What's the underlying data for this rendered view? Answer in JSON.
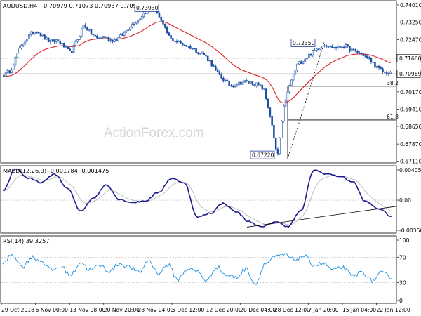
{
  "header": {
    "symbol": "AUDUSD,H4",
    "ohlc": "0.70979 0.71073 0.70937 0.70969"
  },
  "watermark": "ActionForex.com",
  "colors": {
    "candles": "#1a4fa3",
    "ema": "#e0202a",
    "macd": "#1c1c8c",
    "signal": "#b8b8b8",
    "rsi": "#1e90e0",
    "tag": "#1f3fa0"
  },
  "chart_data": [
    {
      "type": "candlestick",
      "title": "AUDUSD,H4",
      "ylim": [
        0.671,
        0.741
      ],
      "y_ticks": [
        "0.74010",
        "0.73250",
        "0.72470",
        "0.71660",
        "0.70969",
        "0.70170",
        "0.69410",
        "0.68650",
        "0.67870",
        "0.67110"
      ],
      "x_ticks": [
        "29 Oct 2018",
        "6 Nov 00:00",
        "13 Nov 08:00",
        "20 Nov 20:00",
        "28 Nov 04:00",
        "5 Dec 12:00",
        "12 Dec 20:00",
        "20 Dec 04:00",
        "28 Dec 12:00",
        "7 Jan 20:00",
        "15 Jan 04:00",
        "22 Jan 12:00"
      ],
      "current_price": 0.70969,
      "horizontal_level": 0.7166,
      "price_tags": [
        {
          "label": "0.73930",
          "value": 0.7393
        },
        {
          "label": "0.72350",
          "value": 0.7235
        },
        {
          "label": "0.67220",
          "value": 0.6722
        }
      ],
      "fib_levels": [
        {
          "label": "38.2",
          "value": 0.7042
        },
        {
          "label": "61.8",
          "value": 0.6893
        }
      ],
      "ema_visible": true,
      "close_path": [
        0.7091,
        0.7112,
        0.7184,
        0.7238,
        0.7272,
        0.7288,
        0.7256,
        0.7237,
        0.7246,
        0.7218,
        0.7187,
        0.7245,
        0.7315,
        0.7277,
        0.7253,
        0.7262,
        0.7246,
        0.7248,
        0.7275,
        0.731,
        0.733,
        0.7364,
        0.7388,
        0.7371,
        0.7302,
        0.7251,
        0.7238,
        0.7226,
        0.7214,
        0.7196,
        0.7182,
        0.7148,
        0.7101,
        0.707,
        0.7043,
        0.7052,
        0.7063,
        0.7058,
        0.7049,
        0.703,
        0.6905,
        0.6722,
        0.6954,
        0.7059,
        0.7136,
        0.7161,
        0.7185,
        0.7207,
        0.7228,
        0.7216,
        0.7212,
        0.7222,
        0.7203,
        0.719,
        0.718,
        0.7154,
        0.7123,
        0.7103,
        0.7097
      ]
    },
    {
      "type": "line",
      "title": "MACD(12,26,9) -0.001784 -0.001475",
      "ylim": [
        -0.0041,
        0.0042
      ],
      "y_ticks": [
        "0.004055",
        "0.00",
        "-0.003662"
      ],
      "values_path": [
        0.0012,
        0.0041,
        0.0028,
        0.0023,
        0.0034,
        0.0015,
        -0.0014,
        0.0003,
        0.002,
        0.0001,
        -0.0003,
        -0.0001,
        0.001,
        0.0028,
        0.0023,
        -0.0022,
        -0.0017,
        -0.0004,
        -0.0015,
        -0.0028,
        -0.0035,
        -0.0028,
        -0.0034,
        -0.0014,
        0.0039,
        0.0034,
        0.0031,
        0.0024,
        -0.0002,
        -0.0011,
        -0.0021
      ]
    },
    {
      "type": "line",
      "title": "RSI(14) 39.3257",
      "ylim": [
        0,
        100
      ],
      "y_ticks": [
        "100",
        "70",
        "30",
        "0"
      ],
      "values_path": [
        60,
        75,
        55,
        70,
        64,
        50,
        55,
        42,
        62,
        50,
        57,
        48,
        60,
        55,
        46,
        65,
        45,
        58,
        35,
        52,
        48,
        33,
        55,
        42,
        38,
        52,
        28,
        60,
        70,
        74,
        66,
        72,
        58,
        60,
        50,
        54,
        40,
        47,
        33,
        45,
        39
      ]
    }
  ]
}
